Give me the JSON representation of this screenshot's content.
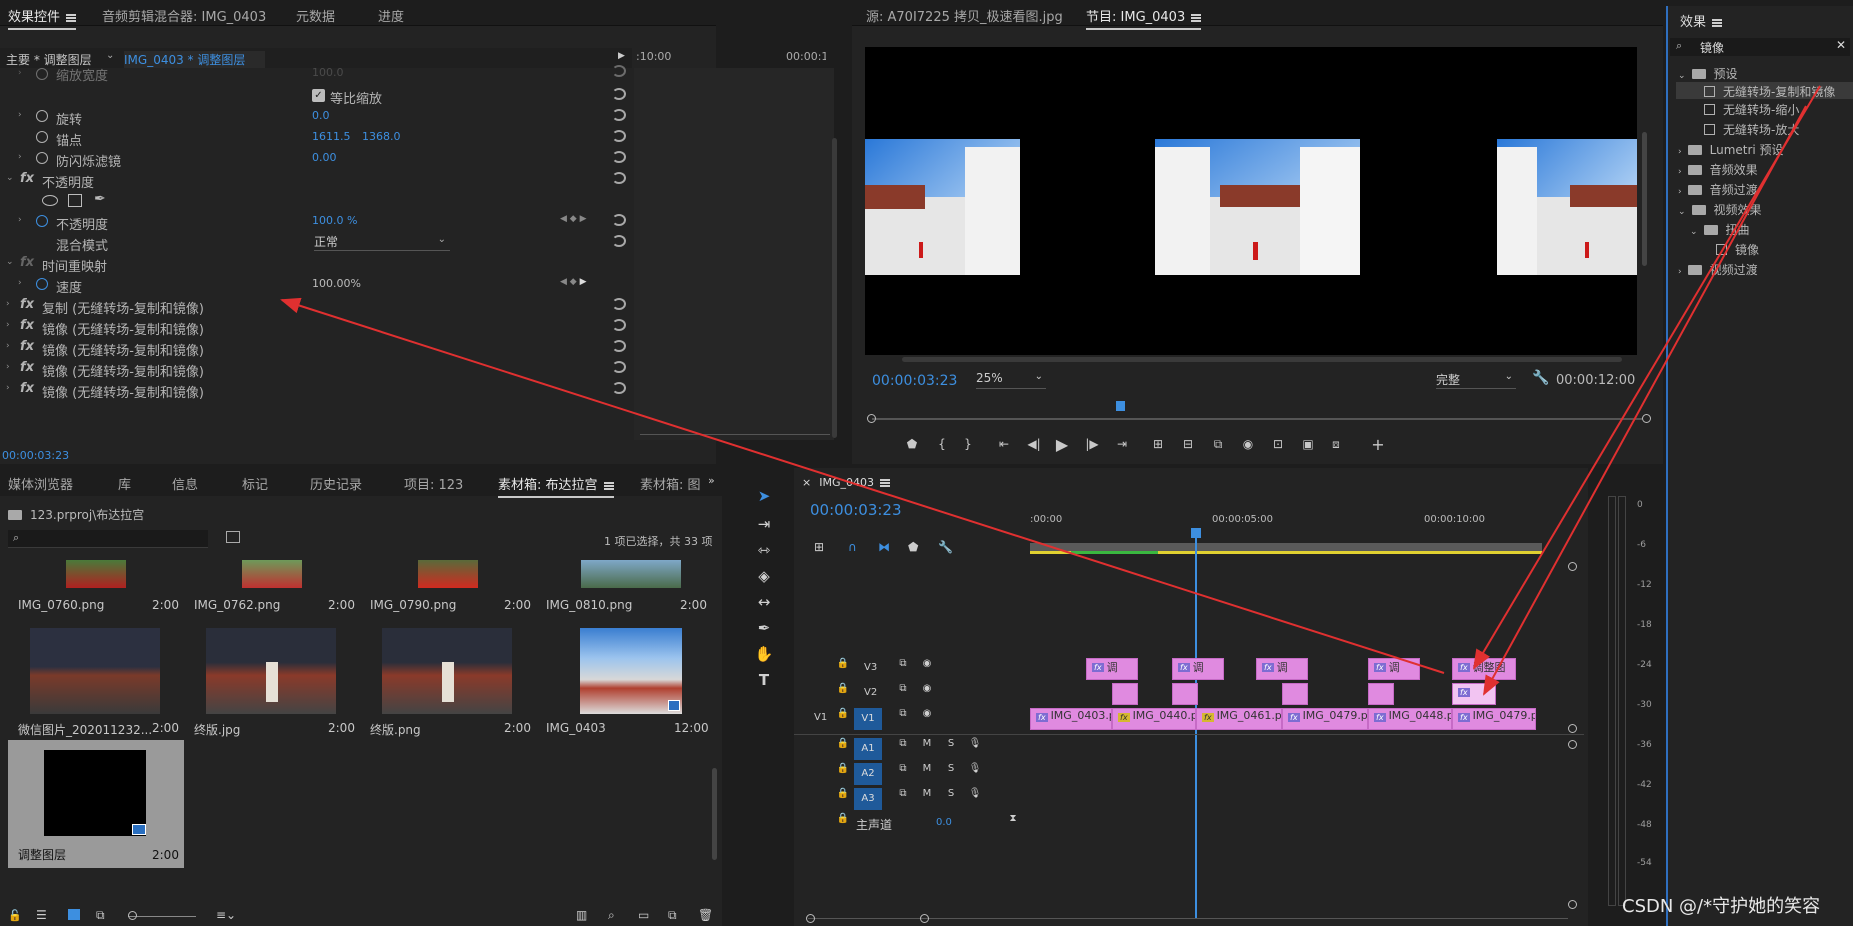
{
  "effect_controls": {
    "tabs": [
      "效果控件",
      "音频剪辑混合器: IMG_0403",
      "元数据",
      "进度"
    ],
    "breadcrumb_master": "主要 * 调整图层",
    "breadcrumb_clip": "IMG_0403 * 调整图层",
    "ruler_time_a": ":10:00",
    "ruler_time_b": "00:00:1",
    "rows": {
      "scale_width_label": "缩放宽度",
      "scale_width_value": "100.0",
      "uniform_scale_label": "等比缩放",
      "rotation_label": "旋转",
      "rotation_value": "0.0",
      "anchor_label": "锚点",
      "anchor_x": "1611.5",
      "anchor_y": "1368.0",
      "antiflicker_label": "防闪烁滤镜",
      "antiflicker_value": "0.00",
      "opacity_group": "不透明度",
      "opacity_label": "不透明度",
      "opacity_value": "100.0 %",
      "blend_label": "混合模式",
      "blend_value": "正常",
      "time_remap_group": "时间重映射",
      "speed_label": "速度",
      "speed_value": "100.00%",
      "fx1": "复制 (无缝转场-复制和镜像)",
      "fx2": "镜像 (无缝转场-复制和镜像)",
      "fx3": "镜像 (无缝转场-复制和镜像)",
      "fx4": "镜像 (无缝转场-复制和镜像)",
      "fx5": "镜像 (无缝转场-复制和镜像)"
    },
    "fx_icon": "fx",
    "current_time": "00:00:03:23"
  },
  "program_monitor": {
    "source_tab": "源: A70I7225 拷贝_极速看图.jpg",
    "program_tab": "节目: IMG_0403",
    "timecode": "00:00:03:23",
    "zoom": "25%",
    "quality": "完整",
    "duration": "00:00:12:00"
  },
  "project_panel": {
    "tabs": [
      "媒体浏览器",
      "库",
      "信息",
      "标记",
      "历史记录",
      "项目: 123",
      "素材箱: 布达拉宫",
      "素材箱: 图"
    ],
    "path": "123.prproj\\布达拉宫",
    "selection_info": "1 项已选择，共 33 项",
    "items": [
      {
        "name": "IMG_0760.png",
        "dur": "2:00"
      },
      {
        "name": "IMG_0762.png",
        "dur": "2:00"
      },
      {
        "name": "IMG_0790.png",
        "dur": "2:00"
      },
      {
        "name": "IMG_0810.png",
        "dur": "2:00"
      },
      {
        "name": "微信图片_202011232...",
        "dur": "2:00"
      },
      {
        "name": "终版.jpg",
        "dur": "2:00"
      },
      {
        "name": "终版.png",
        "dur": "2:00"
      },
      {
        "name": "IMG_0403",
        "dur": "12:00"
      },
      {
        "name": "调整图层",
        "dur": "2:00"
      }
    ]
  },
  "timeline": {
    "tab": "IMG_0403",
    "timecode": "00:00:03:23",
    "ruler": [
      ":00:00",
      "00:00:05:00",
      "00:00:10:00"
    ],
    "v_tracks": [
      "V3",
      "V2",
      "V1"
    ],
    "a_tracks": [
      "A1",
      "A2",
      "A3"
    ],
    "v1_source": "V1",
    "master_label": "主声道",
    "master_value": "0.0",
    "mute": "M",
    "solo": "S",
    "v3_clips": [
      "调",
      "调",
      "调",
      "调",
      "调整图"
    ],
    "v1_clips": [
      "IMG_0403.p",
      "IMG_0440.p",
      "IMG_0461.p",
      "IMG_0479.p",
      "IMG_0448.p",
      "IMG_0479.p"
    ],
    "fx_badge": "fx"
  },
  "effects_panel": {
    "title": "效果",
    "search_value": "镜像",
    "tree": {
      "presets": "预设",
      "preset1": "无缝转场-复制和镜像",
      "preset2": "无缝转场-缩小",
      "preset3": "无缝转场-放大",
      "lumetri": "Lumetri 预设",
      "audio_effects": "音频效果",
      "audio_transitions": "音频过渡",
      "video_effects": "视频效果",
      "distort": "扭曲",
      "mirror": "镜像",
      "video_transitions": "视频过渡"
    }
  },
  "audio_meter": {
    "ticks": [
      "0",
      "-6",
      "-12",
      "-18",
      "-24",
      "-30",
      "-36",
      "-42",
      "-48",
      "-54"
    ]
  },
  "watermark": "CSDN @/*守护她的笑容",
  "colors": {
    "accent_blue": "#3d8fe0",
    "clip_pink": "#e08ae0",
    "arrow_red": "#e03030"
  }
}
